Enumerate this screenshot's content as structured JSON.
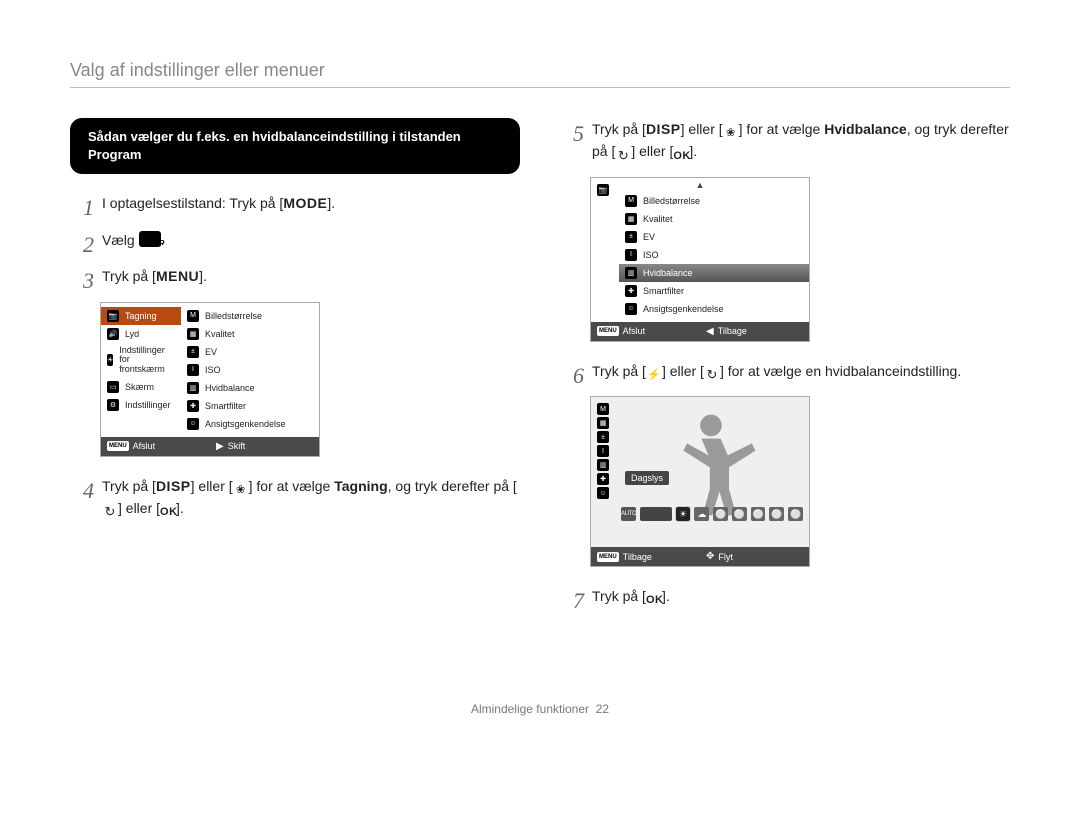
{
  "page": {
    "title": "Valg af indstillinger eller menuer",
    "black_box": "Sådan vælger du f.eks. en hvidbalanceindstilling i tilstanden Program",
    "footer_label": "Almindelige funktioner",
    "footer_page": "22"
  },
  "steps": {
    "s1_a": "I optagelsestilstand: Tryk på [",
    "s1_key": "MODE",
    "s1_b": "].",
    "s2_a": "Vælg ",
    "s2_cam_aria": "camera-p-icon",
    "s2_b": ".",
    "s3_a": "Tryk på [",
    "s3_key": "MENU",
    "s3_b": "].",
    "s4_a": "Tryk på [",
    "s4_key1": "DISP",
    "s4_b": "] eller [",
    "s4_icon1": "flower-icon",
    "s4_c": "] for at vælge ",
    "s4_bold": "Tagning",
    "s4_d": ", og tryk derefter på [",
    "s4_icon2": "timer-icon",
    "s4_e": "] eller [",
    "s4_key2": "OK",
    "s4_f": "].",
    "s5_a": "Tryk på  [",
    "s5_key1": "DISP",
    "s5_b": "] eller [",
    "s5_icon1": "flower-icon",
    "s5_c": "] for at vælge ",
    "s5_bold": "Hvidbalance",
    "s5_d": ", og tryk derefter på [",
    "s5_icon2": "timer-icon",
    "s5_e": "] eller [",
    "s5_key2": "OK",
    "s5_f": "].",
    "s6_a": "Tryk på [",
    "s6_icon1": "flash-icon",
    "s6_b": "] eller [",
    "s6_icon2": "timer-icon",
    "s6_c": "] for at vælge en hvidbalanceindstilling.",
    "s7_a": "Tryk på [",
    "s7_key": "OK",
    "s7_b": "]."
  },
  "shot1": {
    "left": [
      {
        "icon": "camera-icon",
        "label": "Tagning",
        "sel": true
      },
      {
        "icon": "speaker-icon",
        "label": "Lyd"
      },
      {
        "icon": "sun-icon",
        "label": "Indstillinger for frontskærm"
      },
      {
        "icon": "display-icon",
        "label": "Skærm"
      },
      {
        "icon": "gear-icon",
        "label": "Indstillinger"
      }
    ],
    "right": [
      {
        "label": "Billedstørrelse"
      },
      {
        "label": "Kvalitet"
      },
      {
        "label": "EV"
      },
      {
        "label": "ISO"
      },
      {
        "label": "Hvidbalance"
      },
      {
        "label": "Smartfilter"
      },
      {
        "label": "Ansigtsgenkendelse"
      }
    ],
    "footer_left_label": "Afslut",
    "footer_left_key": "MENU",
    "footer_right_label": "Skift",
    "footer_right_arrow": "▶"
  },
  "shot2": {
    "strip": [
      {
        "name": "camera-icon"
      },
      {
        "name": "speaker-icon"
      },
      {
        "name": "sun-icon"
      },
      {
        "name": "display-icon"
      },
      {
        "name": "gear-icon"
      }
    ],
    "list": [
      {
        "label": "Billedstørrelse"
      },
      {
        "label": "Kvalitet"
      },
      {
        "label": "EV"
      },
      {
        "label": "ISO"
      },
      {
        "label": "Hvidbalance",
        "sel": true
      },
      {
        "label": "Smartfilter"
      },
      {
        "label": "Ansigtsgenkendelse"
      }
    ],
    "footer_left_label": "Afslut",
    "footer_left_key": "MENU",
    "footer_right_label": "Tilbage",
    "footer_right_arrow": "◀"
  },
  "shot3": {
    "label_pill": "Dagslys",
    "row": [
      {
        "t": "AUTO",
        "cls": "auto"
      },
      {
        "t": "",
        "cls": "macro-wide"
      },
      {
        "t": "☀",
        "cls": "sel"
      },
      {
        "t": "☁"
      },
      {
        "t": "⚪"
      },
      {
        "t": "⚪"
      },
      {
        "t": "⚪"
      },
      {
        "t": "⚪"
      },
      {
        "t": "⚪"
      }
    ],
    "footer_left_label": "Tilbage",
    "footer_left_key": "MENU",
    "footer_right_label": "Flyt",
    "footer_right_arrow": "✥"
  }
}
